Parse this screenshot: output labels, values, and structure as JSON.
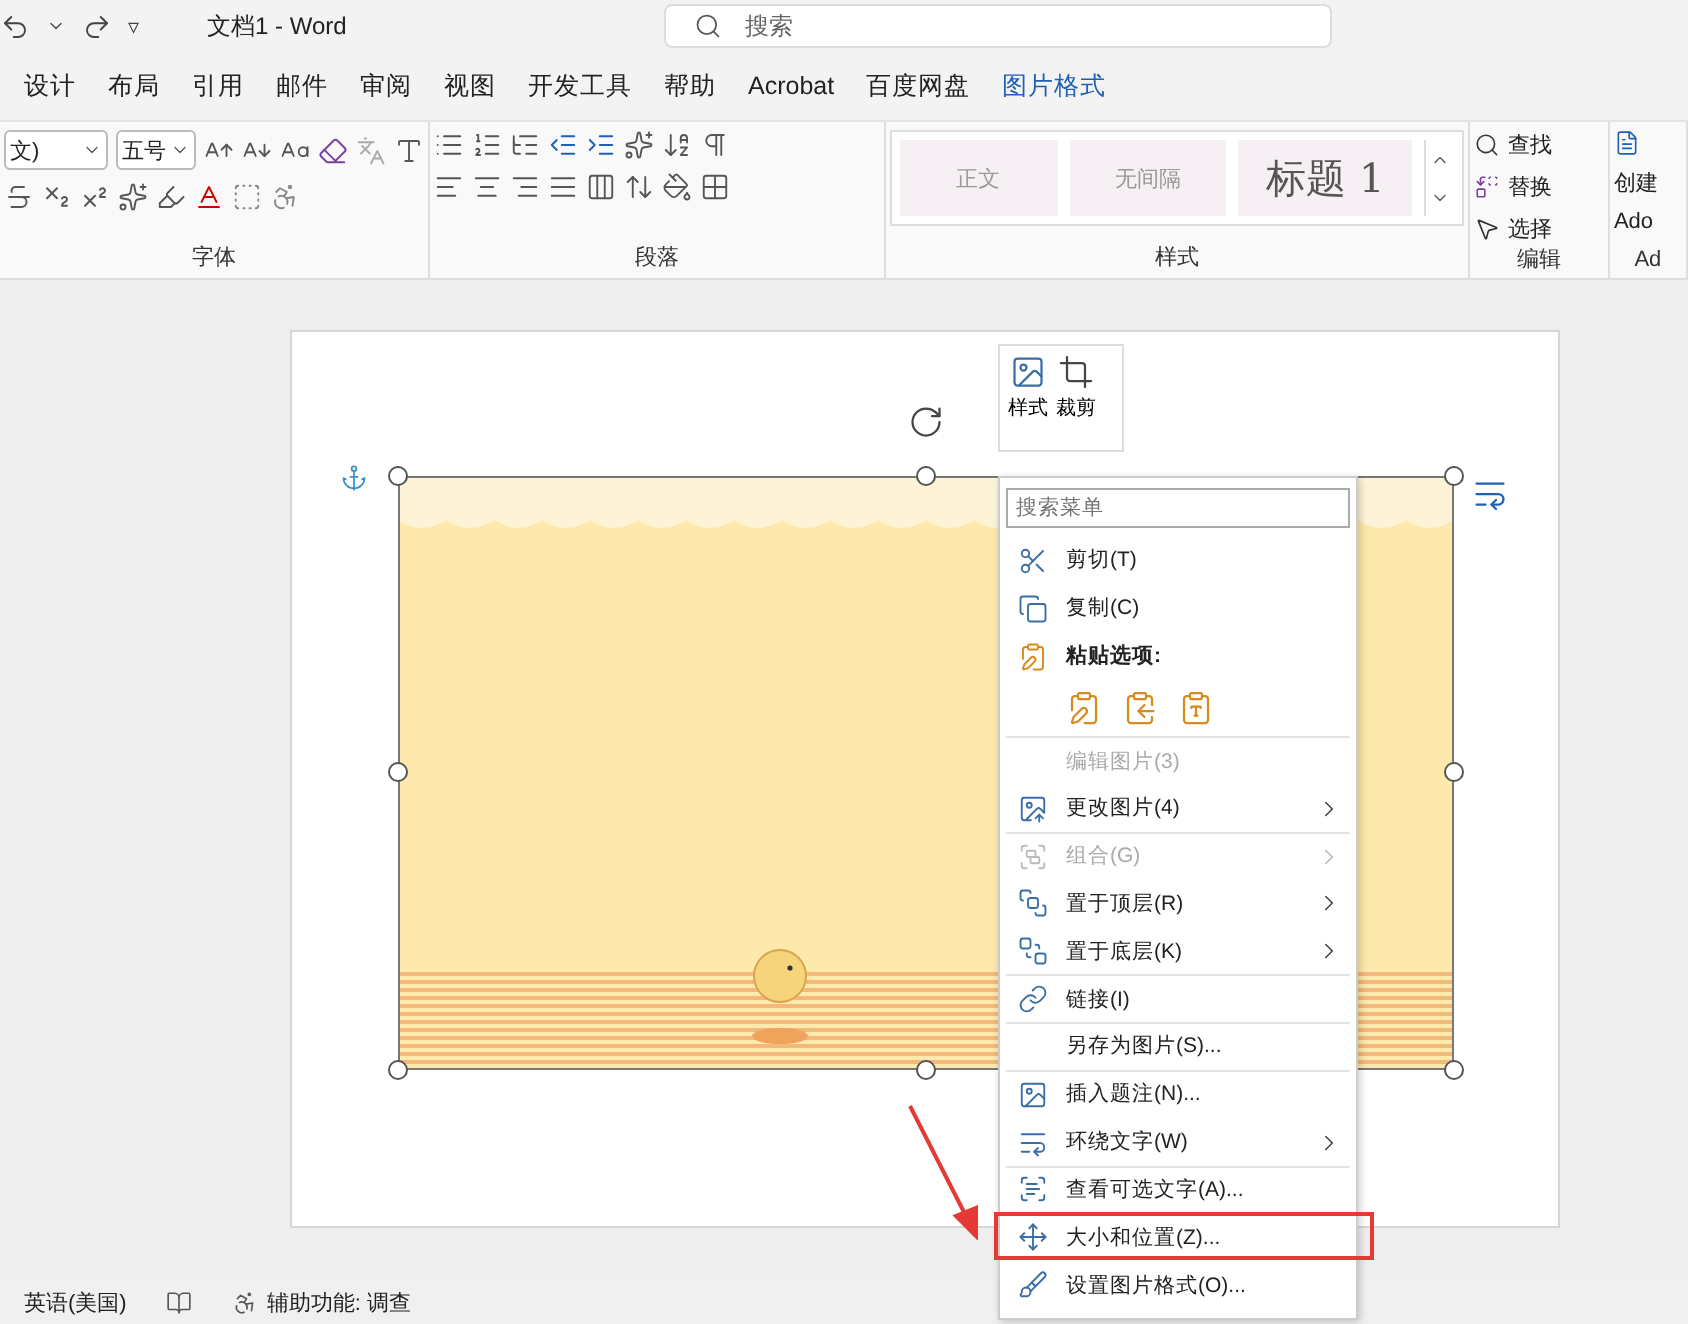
{
  "title_bar": {
    "title": "文档1 - Word",
    "customize_glyph": "▿",
    "search": {
      "placeholder": "搜索"
    }
  },
  "tabs": [
    {
      "label": "设计",
      "selected": false
    },
    {
      "label": "布局",
      "selected": false
    },
    {
      "label": "引用",
      "selected": false
    },
    {
      "label": "邮件",
      "selected": false
    },
    {
      "label": "审阅",
      "selected": false
    },
    {
      "label": "视图",
      "selected": false
    },
    {
      "label": "开发工具",
      "selected": false
    },
    {
      "label": "帮助",
      "selected": false
    },
    {
      "label": "Acrobat",
      "selected": false
    },
    {
      "label": "百度网盘",
      "selected": false
    },
    {
      "label": "图片格式",
      "selected": true
    }
  ],
  "ribbon": {
    "font_name": "文)",
    "font_size": "五号",
    "font_group": "字体",
    "paragraph_group": "段落",
    "styles_group": "样式",
    "styles": [
      {
        "label": "正文",
        "kind": "normal"
      },
      {
        "label": "无间隔",
        "kind": "normal"
      },
      {
        "label": "标题 1",
        "kind": "heading"
      }
    ],
    "editing_group": "编辑",
    "editing": [
      "查找",
      "替换",
      "选择"
    ],
    "adobe_group": "Ad",
    "adobe": [
      "创建",
      "Ado"
    ]
  },
  "picture_toolbar": {
    "buttons": [
      "样式",
      "裁剪"
    ]
  },
  "context_menu": {
    "search": {
      "placeholder": "搜索菜单"
    },
    "items": [
      {
        "kind": "command",
        "label": "剪切(T)",
        "disabled": false,
        "submenu": false,
        "divider": false,
        "highlighted": false
      },
      {
        "kind": "command",
        "label": "复制(C)",
        "disabled": false,
        "submenu": false,
        "divider": false,
        "highlighted": false
      },
      {
        "kind": "heading",
        "label": "粘贴选项:"
      },
      {
        "kind": "paste_options"
      },
      {
        "kind": "command",
        "label": "编辑图片(3)",
        "disabled": true,
        "submenu": false,
        "divider": true,
        "highlighted": false
      },
      {
        "kind": "command",
        "label": "更改图片(4)",
        "disabled": false,
        "submenu": true,
        "divider": false,
        "highlighted": false
      },
      {
        "kind": "command",
        "label": "组合(G)",
        "disabled": true,
        "submenu": true,
        "divider": true,
        "highlighted": false
      },
      {
        "kind": "command",
        "label": "置于顶层(R)",
        "disabled": false,
        "submenu": true,
        "divider": false,
        "highlighted": false
      },
      {
        "kind": "command",
        "label": "置于底层(K)",
        "disabled": false,
        "submenu": true,
        "divider": false,
        "highlighted": false
      },
      {
        "kind": "command",
        "label": "链接(I)",
        "disabled": false,
        "submenu": false,
        "divider": true,
        "highlighted": false
      },
      {
        "kind": "command",
        "label": "另存为图片(S)...",
        "disabled": false,
        "submenu": false,
        "divider": true,
        "highlighted": false
      },
      {
        "kind": "command",
        "label": "插入题注(N)...",
        "disabled": false,
        "submenu": false,
        "divider": true,
        "highlighted": false
      },
      {
        "kind": "command",
        "label": "环绕文字(W)",
        "disabled": false,
        "submenu": true,
        "divider": false,
        "highlighted": false
      },
      {
        "kind": "command",
        "label": "查看可选文字(A)...",
        "disabled": false,
        "submenu": false,
        "divider": true,
        "highlighted": false
      },
      {
        "kind": "command",
        "label": "大小和位置(Z)...",
        "disabled": false,
        "submenu": false,
        "divider": false,
        "highlighted": true
      },
      {
        "kind": "command",
        "label": "设置图片格式(O)...",
        "disabled": false,
        "submenu": false,
        "divider": false,
        "highlighted": false
      }
    ]
  },
  "status_bar": {
    "language": "英语(美国)",
    "accessibility": "辅助功能: 调查"
  }
}
